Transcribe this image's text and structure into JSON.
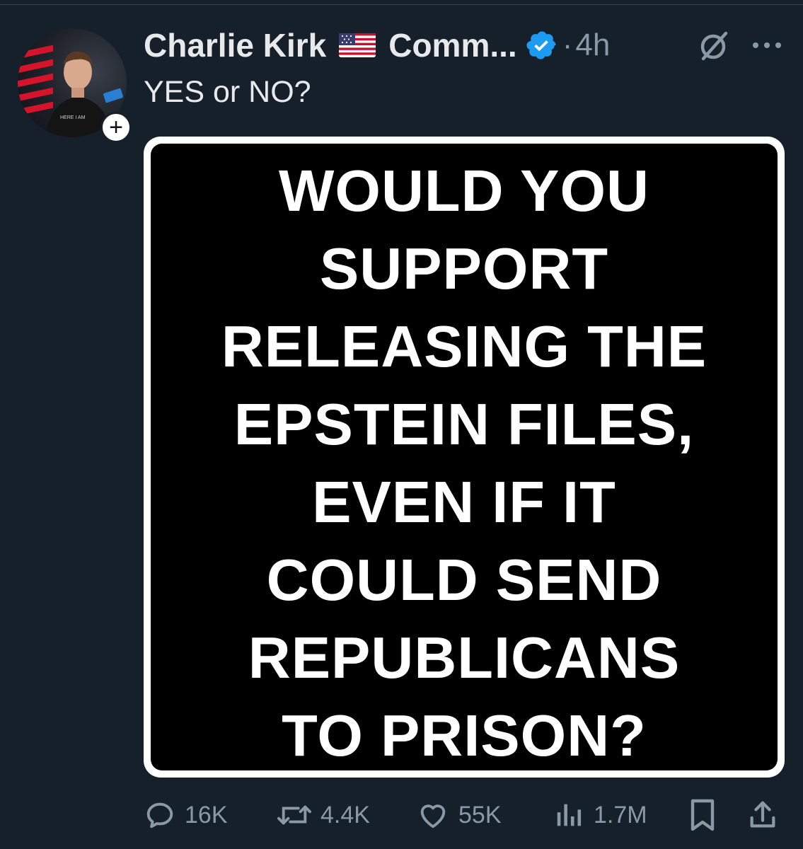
{
  "post": {
    "author_name": "Charlie Kirk",
    "flag_icon": "us-flag-icon",
    "community_label": "Comm...",
    "verified_icon": "verified-badge-icon",
    "separator": "·",
    "timestamp": "4h",
    "text": "YES or NO?",
    "follow_symbol": "+"
  },
  "media": {
    "lines": [
      "WOULD YOU",
      "SUPPORT",
      "RELEASING THE",
      "EPSTEIN FILES,",
      "EVEN IF IT",
      "COULD SEND",
      "REPUBLICANS",
      "TO PRISON?"
    ]
  },
  "actions": {
    "replies": "16K",
    "reposts": "4.4K",
    "likes": "55K",
    "views": "1.7M"
  },
  "colors": {
    "background": "#15202b",
    "text_primary": "#e7e9ea",
    "text_secondary": "#8b98a5",
    "verified_blue": "#1d9bf0"
  }
}
